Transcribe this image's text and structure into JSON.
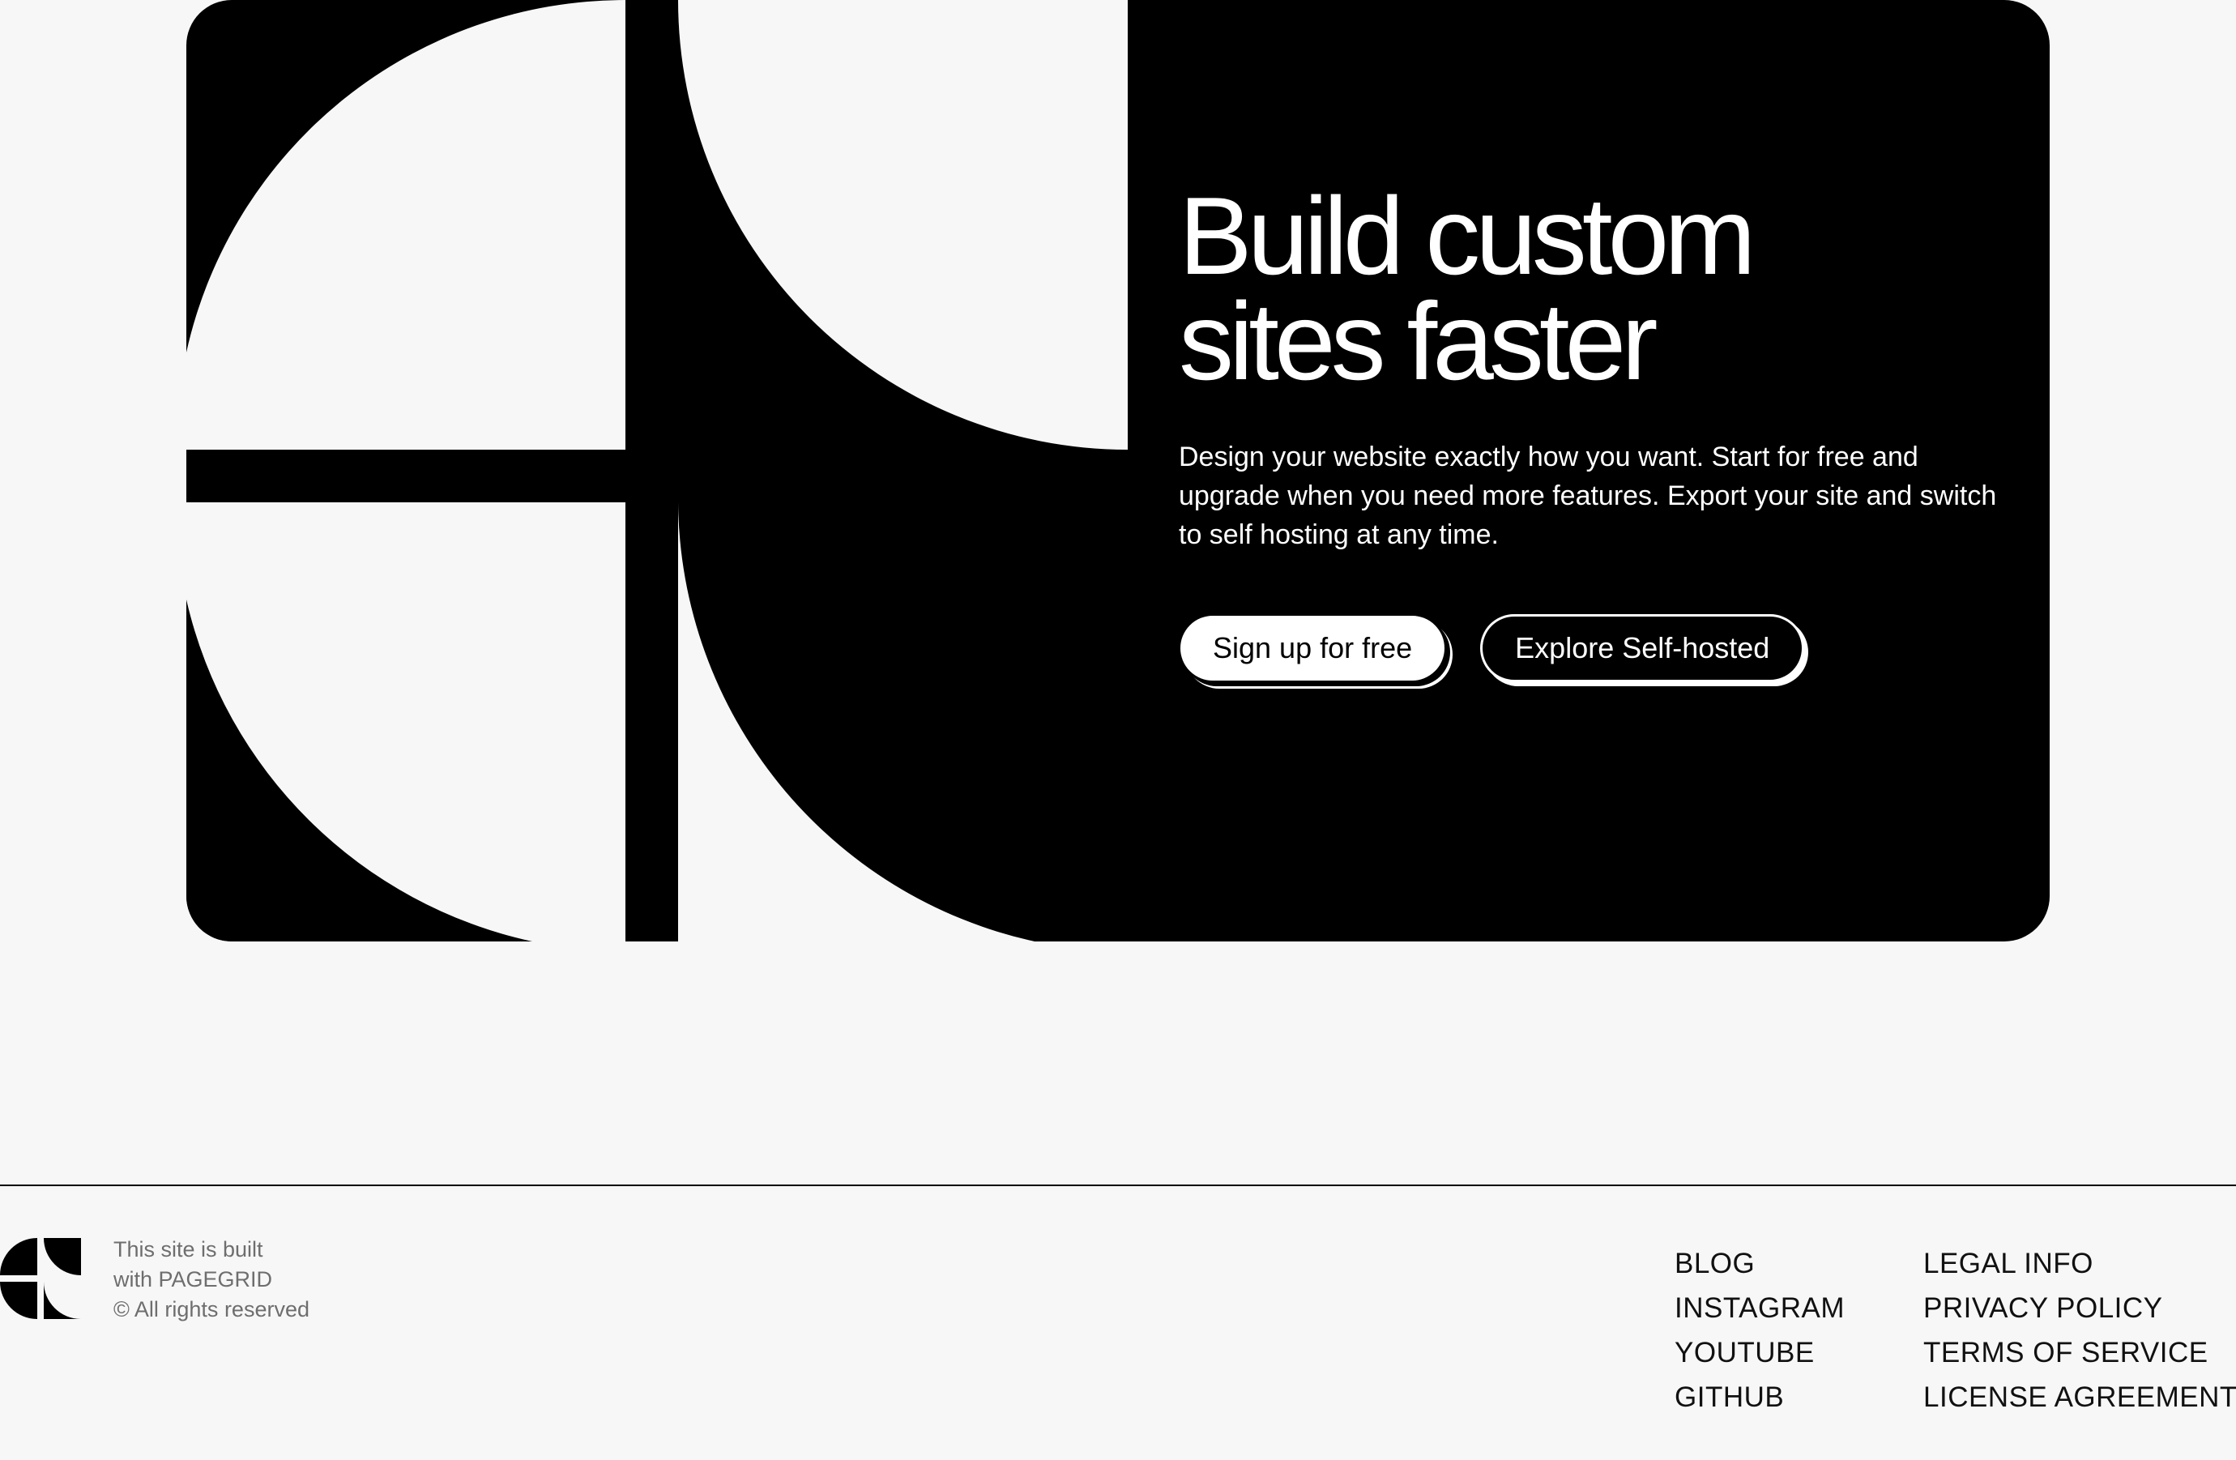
{
  "hero": {
    "title_line1": "Build custom",
    "title_line2": "sites faster",
    "description": "Design your website exactly how you want. Start for free and upgrade when you need more features. Export your site and switch to self hosting at any time.",
    "primary_button": "Sign up for free",
    "secondary_button": "Explore Self-hosted"
  },
  "footer": {
    "credit_line1": "This site is built",
    "credit_line2": "with PAGEGRID",
    "credit_line3": "© All rights reserved",
    "links_col1": [
      "BLOG",
      "INSTAGRAM",
      "YOUTUBE",
      "GITHUB"
    ],
    "links_col2": [
      "LEGAL INFO",
      "PRIVACY POLICY",
      "TERMS OF SERVICE",
      "LICENSE AGREEMENT"
    ]
  },
  "colors": {
    "background": "#f7f7f7",
    "card": "#000000",
    "text_on_card": "#ffffff",
    "footer_muted": "#6e6e6e"
  },
  "icons": {
    "hero_graphic": "pagegrid-quarter-circles-graphic",
    "footer_logo": "pagegrid-logo-icon"
  }
}
